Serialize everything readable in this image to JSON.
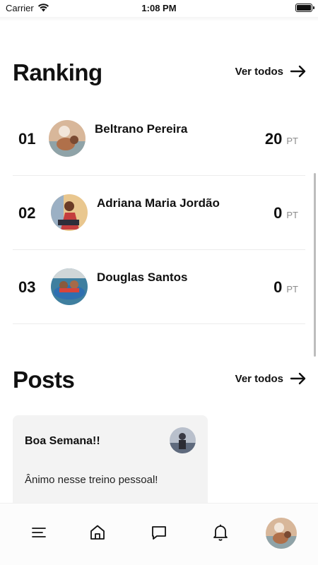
{
  "status_bar": {
    "carrier": "Carrier",
    "time": "1:08 PM"
  },
  "ranking": {
    "title": "Ranking",
    "see_all_label": "Ver todos",
    "items": [
      {
        "position": "01",
        "name": "Beltrano Pereira",
        "points": "20",
        "unit": "PT",
        "avatar_icon": "user-photo-1"
      },
      {
        "position": "02",
        "name": "Adriana Maria Jordão",
        "points": "0",
        "unit": "PT",
        "avatar_icon": "user-photo-2"
      },
      {
        "position": "03",
        "name": "Douglas Santos",
        "points": "0",
        "unit": "PT",
        "avatar_icon": "user-photo-3"
      }
    ]
  },
  "posts": {
    "title": "Posts",
    "see_all_label": "Ver todos",
    "items": [
      {
        "title": "Boa Semana!!",
        "body": "Ânimo nesse treino pessoal!",
        "author_avatar_icon": "user-photo-4"
      }
    ]
  },
  "tab_bar": {
    "tabs": [
      {
        "icon": "menu-icon"
      },
      {
        "icon": "home-icon"
      },
      {
        "icon": "chat-icon"
      },
      {
        "icon": "bell-icon"
      },
      {
        "icon": "profile-avatar"
      }
    ]
  },
  "colors": {
    "text": "#111111",
    "muted": "#8c8c8c",
    "card": "#f3f3f3",
    "divider": "#ececec"
  }
}
